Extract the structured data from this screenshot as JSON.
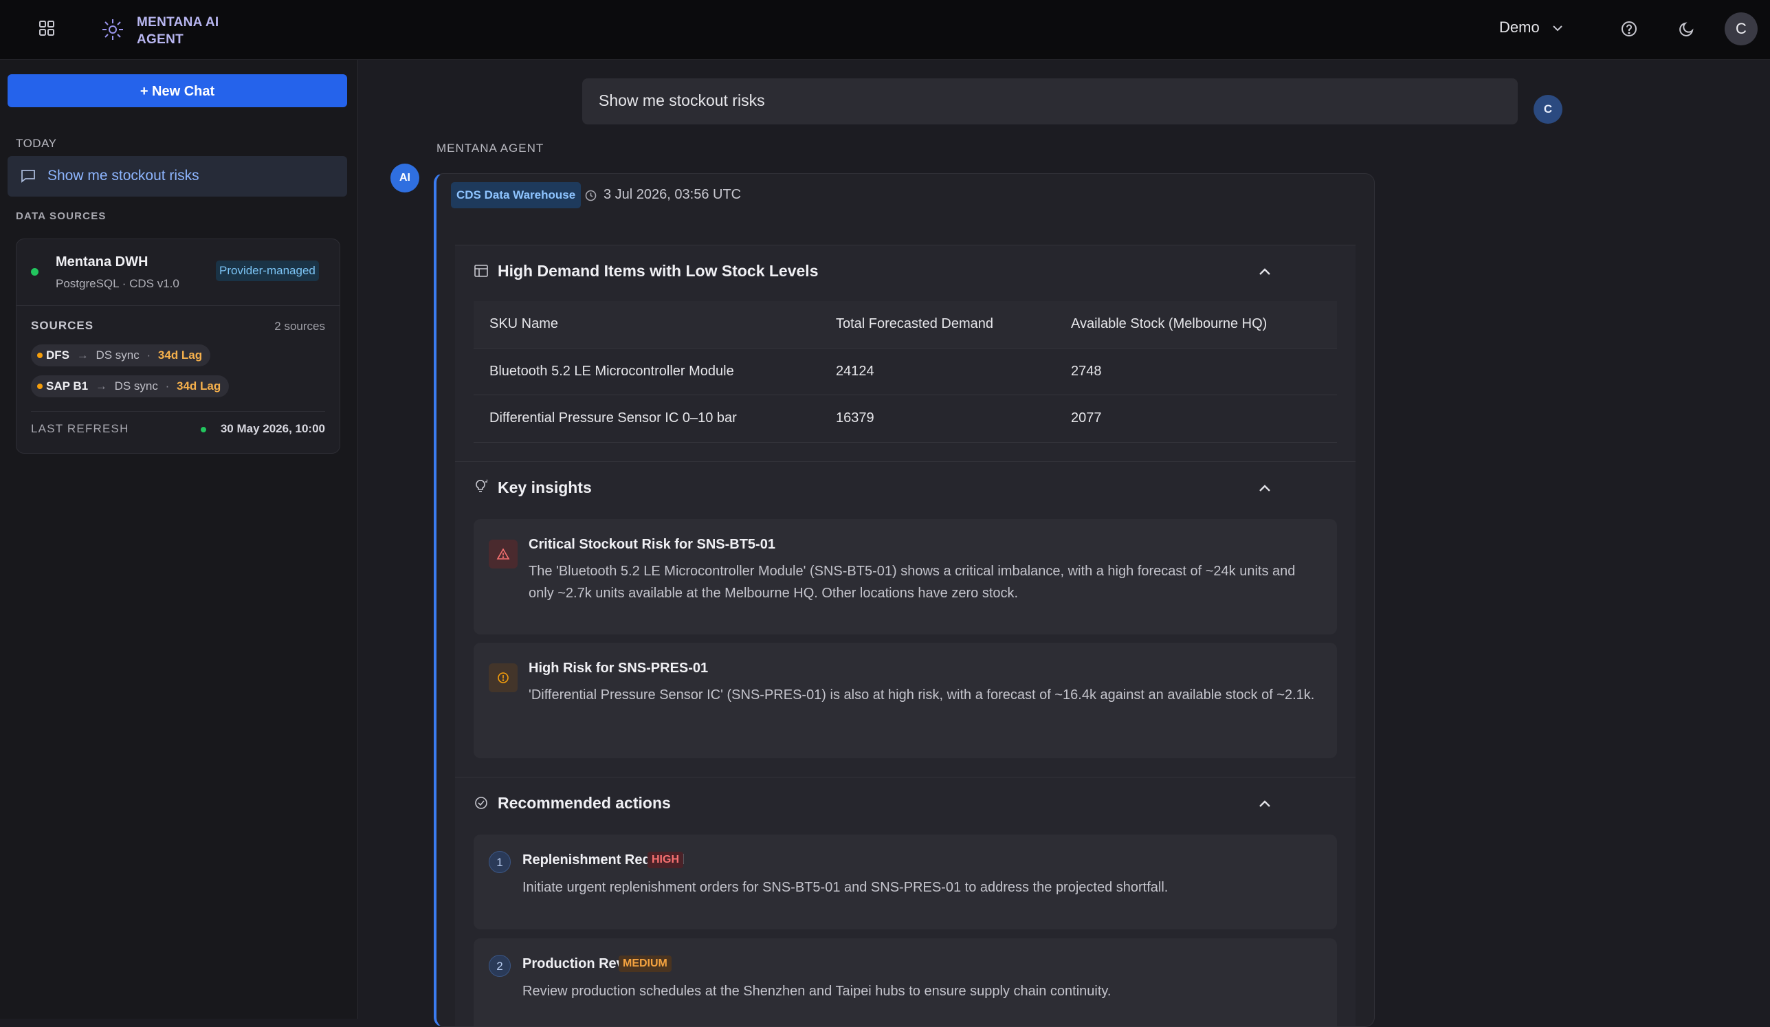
{
  "header": {
    "brand": "MENTANA AI AGENT",
    "workspace": "Demo",
    "avatar_letter": "C"
  },
  "sidebar": {
    "new_chat": "+ New Chat",
    "today_label": "TODAY",
    "chats": [
      {
        "label": "Show me stockout risks"
      }
    ],
    "data_sources_label": "DATA SOURCES",
    "source": {
      "name": "Mentana DWH",
      "sub": "PostgreSQL · CDS v1.0",
      "badge": "Provider-managed",
      "sources_label": "SOURCES",
      "sources_count": "2 sources",
      "items": [
        {
          "name": "DFS",
          "sync": "DS sync",
          "lag": "34d Lag"
        },
        {
          "name": "SAP B1",
          "sync": "DS sync",
          "lag": "34d Lag"
        }
      ],
      "last_refresh_label": "LAST REFRESH",
      "last_refresh_value": "30 May 2026, 10:00"
    }
  },
  "conversation": {
    "user_message": "Show me stockout risks",
    "user_avatar": "C",
    "agent_label": "MENTANA AGENT",
    "agent_avatar": "AI",
    "source_badge": "CDS Data Warehouse",
    "timestamp": "3 Jul 2026, 03:56 UTC",
    "table_section": {
      "title": "High Demand Items with Low Stock Levels",
      "columns": [
        "SKU Name",
        "Total Forecasted Demand",
        "Available Stock (Melbourne HQ)"
      ],
      "rows": [
        [
          "Bluetooth 5.2 LE Microcontroller Module",
          "24124",
          "2748"
        ],
        [
          "Differential Pressure Sensor IC 0–10 bar",
          "16379",
          "2077"
        ]
      ]
    },
    "insights_section": {
      "title": "Key insights",
      "items": [
        {
          "title": "Critical Stockout Risk for SNS-BT5-01",
          "body": "The 'Bluetooth 5.2 LE Microcontroller Module' (SNS-BT5-01) shows a critical imbalance, with a high forecast of ~24k units and only ~2.7k units available at the Melbourne HQ. Other locations have zero stock.",
          "severity": "critical",
          "icon": "warning-triangle-icon"
        },
        {
          "title": "High Risk for SNS-PRES-01",
          "body": "'Differential Pressure Sensor IC' (SNS-PRES-01) is also at high risk, with a forecast of ~16.4k against an available stock of ~2.1k.",
          "severity": "high",
          "icon": "alert-circle-icon"
        }
      ]
    },
    "actions_section": {
      "title": "Recommended actions",
      "items": [
        {
          "num": "1",
          "title": "Replenishment Required",
          "priority": "HIGH",
          "body": "Initiate urgent replenishment orders for SNS-BT5-01 and SNS-PRES-01 to address the projected shortfall."
        },
        {
          "num": "2",
          "title": "Production Review",
          "priority": "MEDIUM",
          "body": "Review production schedules at the Shenzhen and Taipei hubs to ensure supply chain continuity."
        }
      ]
    }
  },
  "colors": {
    "accent": "#2563eb",
    "link": "#8eb6ff",
    "healthy": "#22c55e",
    "lag": "#f5b04c",
    "critical": "#ef4444",
    "warning": "#f59e0b"
  }
}
